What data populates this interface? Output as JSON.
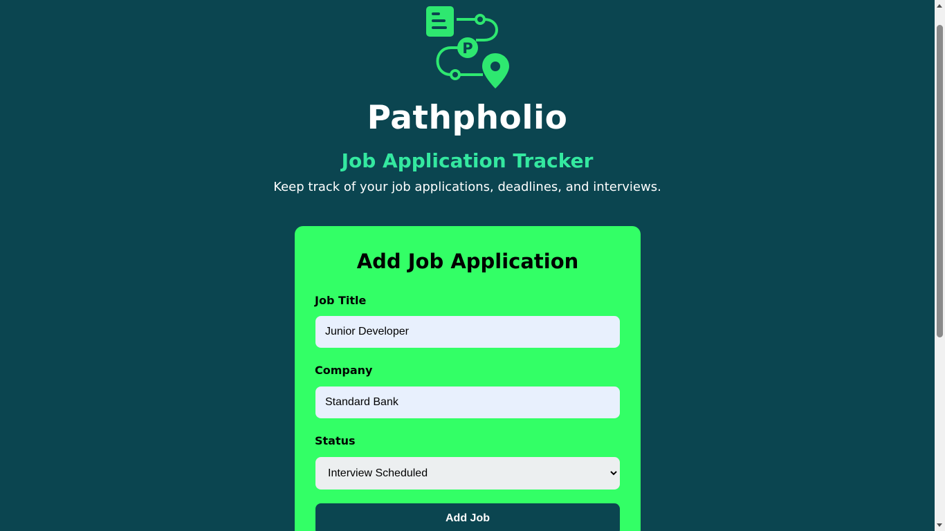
{
  "header": {
    "brand": "Pathpholio",
    "tagline": "Job Application Tracker",
    "subtitle": "Keep track of your job applications, deadlines, and interviews.",
    "logo_letter": "P"
  },
  "form": {
    "title": "Add Job Application",
    "job_title": {
      "label": "Job Title",
      "value": "Junior Developer"
    },
    "company": {
      "label": "Company",
      "value": "Standard Bank"
    },
    "status": {
      "label": "Status",
      "selected": "Interview Scheduled"
    },
    "submit_label": "Add Job"
  },
  "colors": {
    "background": "#0b4550",
    "accent_green": "#33ff66",
    "tagline_teal": "#34e8a0",
    "logo_green": "#2ee870"
  },
  "icons": {
    "logo": "document-route-location-logo-icon",
    "select_chevron": "chevron-down-icon"
  }
}
